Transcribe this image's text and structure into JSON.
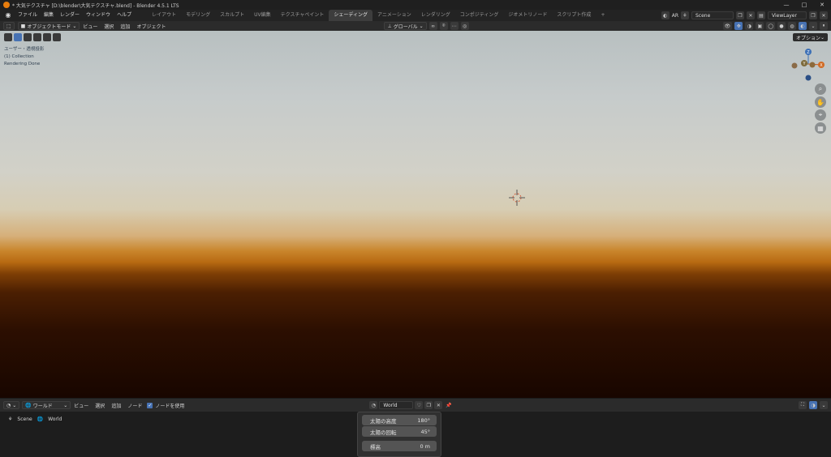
{
  "window": {
    "title": "* 大気テクスチャ [D:\\blender\\大気テクスチャ.blend] - Blender 4.5.1 LTS",
    "minimize": "—",
    "maximize": "□",
    "close": "✕"
  },
  "menubar": {
    "items": [
      "ファイル",
      "編集",
      "レンダー",
      "ウィンドウ",
      "ヘルプ"
    ]
  },
  "workspace_tabs": {
    "items": [
      "レイアウト",
      "モデリング",
      "スカルプト",
      "UV編集",
      "テクスチャペイント",
      "シェーディング",
      "アニメーション",
      "レンダリング",
      "コンポジティング",
      "ジオメトリノード",
      "スクリプト作成"
    ],
    "active": "シェーディング",
    "add": "+"
  },
  "topbar_right": {
    "render_engine_short": "AR",
    "scene": "Scene",
    "view_layer": "ViewLayer"
  },
  "viewport": {
    "mode": "オブジェクトモード",
    "menu": [
      "ビュー",
      "選択",
      "追加",
      "オブジェクト"
    ],
    "orientation": "グローバル",
    "options": "オプション",
    "overlay_lines": [
      "ユーザー・透視投影",
      "(1) Collection",
      "Rendering Done"
    ],
    "gizmo_axes": {
      "x": "X",
      "y": "Y",
      "z": "Z"
    }
  },
  "node_editor": {
    "shader_type": "ワールド",
    "menu": [
      "ビュー",
      "選択",
      "追加",
      "ノード"
    ],
    "use_nodes_label": "ノードを使用",
    "world_name": "World",
    "breadcrumb": [
      "Scene",
      "World"
    ],
    "node_props": [
      {
        "label": "太陽の高度",
        "value": "180°"
      },
      {
        "label": "太陽の回転",
        "value": "45°"
      },
      {
        "label": "標高",
        "value": "0 m"
      }
    ]
  },
  "colors": {
    "accent": "#4772b3",
    "active_tab": "#3d3d3d",
    "horizon_orange": "#c9852c"
  }
}
